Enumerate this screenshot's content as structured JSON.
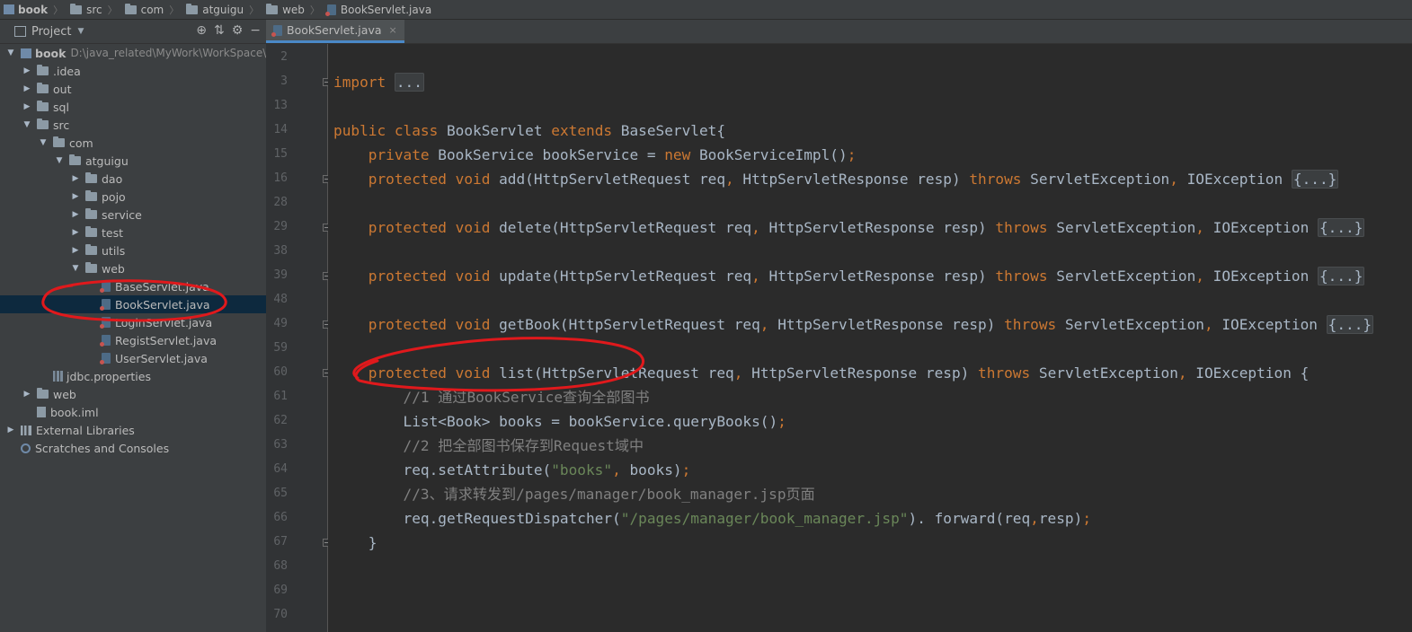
{
  "breadcrumb": [
    "book",
    "src",
    "com",
    "atguigu",
    "web",
    "BookServlet.java"
  ],
  "project_panel": {
    "title": "Project",
    "tools": [
      "target-icon",
      "collapse-icon",
      "gear-icon",
      "minimize-icon"
    ]
  },
  "tree": [
    {
      "label": "book",
      "hint": "D:\\java_related\\MyWork\\WorkSpace\\",
      "icon": "module",
      "depth": 0,
      "arrow": "down",
      "bold": true
    },
    {
      "label": ".idea",
      "icon": "folder",
      "depth": 1,
      "arrow": "right"
    },
    {
      "label": "out",
      "icon": "folder",
      "depth": 1,
      "arrow": "right"
    },
    {
      "label": "sql",
      "icon": "folder",
      "depth": 1,
      "arrow": "right"
    },
    {
      "label": "src",
      "icon": "folder",
      "depth": 1,
      "arrow": "down"
    },
    {
      "label": "com",
      "icon": "folder",
      "depth": 2,
      "arrow": "down"
    },
    {
      "label": "atguigu",
      "icon": "folder",
      "depth": 3,
      "arrow": "down"
    },
    {
      "label": "dao",
      "icon": "folder",
      "depth": 4,
      "arrow": "right"
    },
    {
      "label": "pojo",
      "icon": "folder",
      "depth": 4,
      "arrow": "right"
    },
    {
      "label": "service",
      "icon": "folder",
      "depth": 4,
      "arrow": "right"
    },
    {
      "label": "test",
      "icon": "folder",
      "depth": 4,
      "arrow": "right"
    },
    {
      "label": "utils",
      "icon": "folder",
      "depth": 4,
      "arrow": "right"
    },
    {
      "label": "web",
      "icon": "folder",
      "depth": 4,
      "arrow": "down"
    },
    {
      "label": "BaseServlet.java",
      "icon": "java",
      "depth": 5
    },
    {
      "label": "BookServlet.java",
      "icon": "java",
      "depth": 5,
      "selected": true
    },
    {
      "label": "LoginServlet.java",
      "icon": "java",
      "depth": 5
    },
    {
      "label": "RegistServlet.java",
      "icon": "java",
      "depth": 5
    },
    {
      "label": "UserServlet.java",
      "icon": "java",
      "depth": 5
    },
    {
      "label": "jdbc.properties",
      "icon": "properties",
      "depth": 2
    },
    {
      "label": "web",
      "icon": "folder",
      "depth": 1,
      "arrow": "right"
    },
    {
      "label": "book.iml",
      "icon": "iml",
      "depth": 1
    },
    {
      "label": "External Libraries",
      "icon": "library",
      "depth": 0,
      "arrow": "right"
    },
    {
      "label": "Scratches and Consoles",
      "icon": "scratch",
      "depth": 0
    }
  ],
  "editor_tab": {
    "label": "BookServlet.java",
    "close": "×"
  },
  "line_numbers": [
    "2",
    "3",
    "13",
    "14",
    "15",
    "16",
    "28",
    "29",
    "38",
    "39",
    "48",
    "49",
    "59",
    "60",
    "61",
    "62",
    "63",
    "64",
    "65",
    "66",
    "67",
    "68",
    "69",
    "70"
  ],
  "code_lines": [
    [],
    [
      [
        "kw",
        "import "
      ],
      [
        "fold",
        "..."
      ]
    ],
    [],
    [
      [
        "kw",
        "public class "
      ],
      [
        "",
        "BookServlet "
      ],
      [
        "kw",
        "extends "
      ],
      [
        "",
        "BaseServlet{"
      ]
    ],
    [
      [
        "",
        "    "
      ],
      [
        "kw",
        "private "
      ],
      [
        "",
        "BookService bookService = "
      ],
      [
        "kw",
        "new "
      ],
      [
        "",
        "BookServiceImpl()"
      ],
      [
        "kw",
        ";"
      ]
    ],
    [
      [
        "",
        "    "
      ],
      [
        "kw",
        "protected void "
      ],
      [
        "",
        "add(HttpServletRequest req"
      ],
      [
        "kw",
        ", "
      ],
      [
        "",
        "HttpServletResponse resp) "
      ],
      [
        "kw",
        "throws "
      ],
      [
        "",
        "ServletException"
      ],
      [
        "kw",
        ", "
      ],
      [
        "",
        "IOException "
      ],
      [
        "fold",
        "{...}"
      ]
    ],
    [],
    [
      [
        "",
        "    "
      ],
      [
        "kw",
        "protected void "
      ],
      [
        "",
        "delete(HttpServletRequest req"
      ],
      [
        "kw",
        ", "
      ],
      [
        "",
        "HttpServletResponse resp) "
      ],
      [
        "kw",
        "throws "
      ],
      [
        "",
        "ServletException"
      ],
      [
        "kw",
        ", "
      ],
      [
        "",
        "IOException "
      ],
      [
        "fold",
        "{...}"
      ]
    ],
    [],
    [
      [
        "",
        "    "
      ],
      [
        "kw",
        "protected void "
      ],
      [
        "",
        "update(HttpServletRequest req"
      ],
      [
        "kw",
        ", "
      ],
      [
        "",
        "HttpServletResponse resp) "
      ],
      [
        "kw",
        "throws "
      ],
      [
        "",
        "ServletException"
      ],
      [
        "kw",
        ", "
      ],
      [
        "",
        "IOException "
      ],
      [
        "fold",
        "{...}"
      ]
    ],
    [],
    [
      [
        "",
        "    "
      ],
      [
        "kw",
        "protected void "
      ],
      [
        "",
        "getBook(HttpServletRequest req"
      ],
      [
        "kw",
        ", "
      ],
      [
        "",
        "HttpServletResponse resp) "
      ],
      [
        "kw",
        "throws "
      ],
      [
        "",
        "ServletException"
      ],
      [
        "kw",
        ", "
      ],
      [
        "",
        "IOException "
      ],
      [
        "fold",
        "{...}"
      ]
    ],
    [],
    [
      [
        "",
        "    "
      ],
      [
        "kw",
        "protected void "
      ],
      [
        "",
        "list(HttpServletRequest req"
      ],
      [
        "kw",
        ", "
      ],
      [
        "",
        "HttpServletResponse resp) "
      ],
      [
        "kw",
        "throws "
      ],
      [
        "",
        "ServletException"
      ],
      [
        "kw",
        ", "
      ],
      [
        "",
        "IOException {"
      ]
    ],
    [
      [
        "cm",
        "        //1 通过BookService查询全部图书"
      ]
    ],
    [
      [
        "",
        "        List<Book> books = bookService.queryBooks()"
      ],
      [
        "kw",
        ";"
      ]
    ],
    [
      [
        "cm",
        "        //2 把全部图书保存到Request域中"
      ]
    ],
    [
      [
        "",
        "        req.setAttribute("
      ],
      [
        "str",
        "\"books\""
      ],
      [
        "kw",
        ", "
      ],
      [
        "",
        "books)"
      ],
      [
        "kw",
        ";"
      ]
    ],
    [
      [
        "cm",
        "        //3、请求转发到/pages/manager/book_manager.jsp页面"
      ]
    ],
    [
      [
        "",
        "        req.getRequestDispatcher("
      ],
      [
        "str",
        "\"/pages/manager/book_manager.jsp\""
      ],
      [
        "",
        "). forward(req"
      ],
      [
        "kw",
        ","
      ],
      [
        "",
        "resp)"
      ],
      [
        "kw",
        ";"
      ]
    ],
    [
      [
        "",
        "    }"
      ]
    ],
    [],
    [],
    []
  ],
  "fold_marker_lines": [
    1,
    5,
    7,
    9,
    11,
    13,
    20
  ],
  "colors": {
    "keyword": "#cc7832",
    "string": "#6a8759",
    "comment": "#808080",
    "text": "#a9b7c6",
    "annotation": "#e0191c"
  }
}
